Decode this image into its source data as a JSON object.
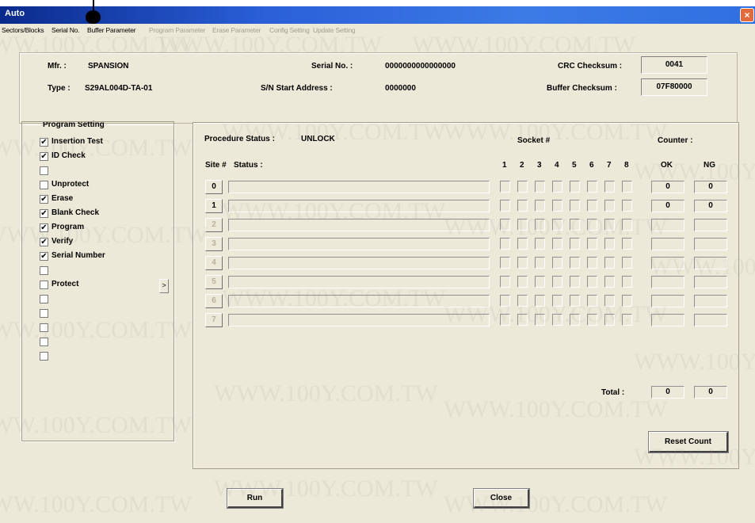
{
  "window": {
    "title": "Auto",
    "close_glyph": "×"
  },
  "menu": [
    {
      "label": "Sectors/Blocks",
      "enabled": true
    },
    {
      "label": "Serial No.",
      "enabled": true
    },
    {
      "label": "Buffer Parameter",
      "enabled": true
    },
    {
      "label": "Program Parameter",
      "enabled": false
    },
    {
      "label": "Erase Parameter",
      "enabled": false
    },
    {
      "label": "Config Setting",
      "enabled": false
    },
    {
      "label": "Update Setting",
      "enabled": false
    }
  ],
  "info": {
    "mfr_label": "Mfr. :",
    "mfr_value": "SPANSION",
    "type_label": "Type :",
    "type_value": "S29AL004D-TA-01",
    "serial_label": "Serial No. :",
    "serial_value": "0000000000000000",
    "sn_start_label": "S/N Start Address :",
    "sn_start_value": "0000000",
    "crc_label": "CRC Checksum :",
    "crc_value": "0041",
    "buffer_label": "Buffer Checksum :",
    "buffer_value": "07F80000"
  },
  "program_setting": {
    "title": "Program Setting",
    "arrow_glyph": ">",
    "items": [
      {
        "label": "Insertion Test",
        "checked": true
      },
      {
        "label": "ID Check",
        "checked": true
      },
      {
        "label": "",
        "checked": false
      },
      {
        "label": "Unprotect",
        "checked": false
      },
      {
        "label": "Erase",
        "checked": true
      },
      {
        "label": "Blank Check",
        "checked": true
      },
      {
        "label": "Program",
        "checked": true
      },
      {
        "label": "Verify",
        "checked": true
      },
      {
        "label": "Serial Number",
        "checked": true
      },
      {
        "label": "",
        "checked": false
      },
      {
        "label": "Protect",
        "checked": false
      },
      {
        "label": "",
        "checked": false
      },
      {
        "label": "",
        "checked": false
      },
      {
        "label": "",
        "checked": false
      },
      {
        "label": "",
        "checked": false
      },
      {
        "label": "",
        "checked": false
      }
    ]
  },
  "status": {
    "procedure_label": "Procedure Status :",
    "procedure_value": "UNLOCK",
    "site_label": "Site #",
    "status_label": "Status :",
    "socket_label": "Socket #",
    "socket_numbers": [
      "1",
      "2",
      "3",
      "4",
      "5",
      "6",
      "7",
      "8"
    ],
    "counter_label": "Counter :",
    "ok_label": "OK",
    "ng_label": "NG",
    "sites": [
      {
        "id": "0",
        "enabled": true,
        "ok": "0",
        "ng": "0"
      },
      {
        "id": "1",
        "enabled": true,
        "ok": "0",
        "ng": "0"
      },
      {
        "id": "2",
        "enabled": false,
        "ok": "",
        "ng": ""
      },
      {
        "id": "3",
        "enabled": false,
        "ok": "",
        "ng": ""
      },
      {
        "id": "4",
        "enabled": false,
        "ok": "",
        "ng": ""
      },
      {
        "id": "5",
        "enabled": false,
        "ok": "",
        "ng": ""
      },
      {
        "id": "6",
        "enabled": false,
        "ok": "",
        "ng": ""
      },
      {
        "id": "7",
        "enabled": false,
        "ok": "",
        "ng": ""
      }
    ],
    "total_label": "Total :",
    "total_ok": "0",
    "total_ng": "0",
    "reset_label": "Reset Count"
  },
  "buttons": {
    "run": "Run",
    "close": "Close"
  },
  "watermark_text": "WWW.100Y.COM.TW"
}
